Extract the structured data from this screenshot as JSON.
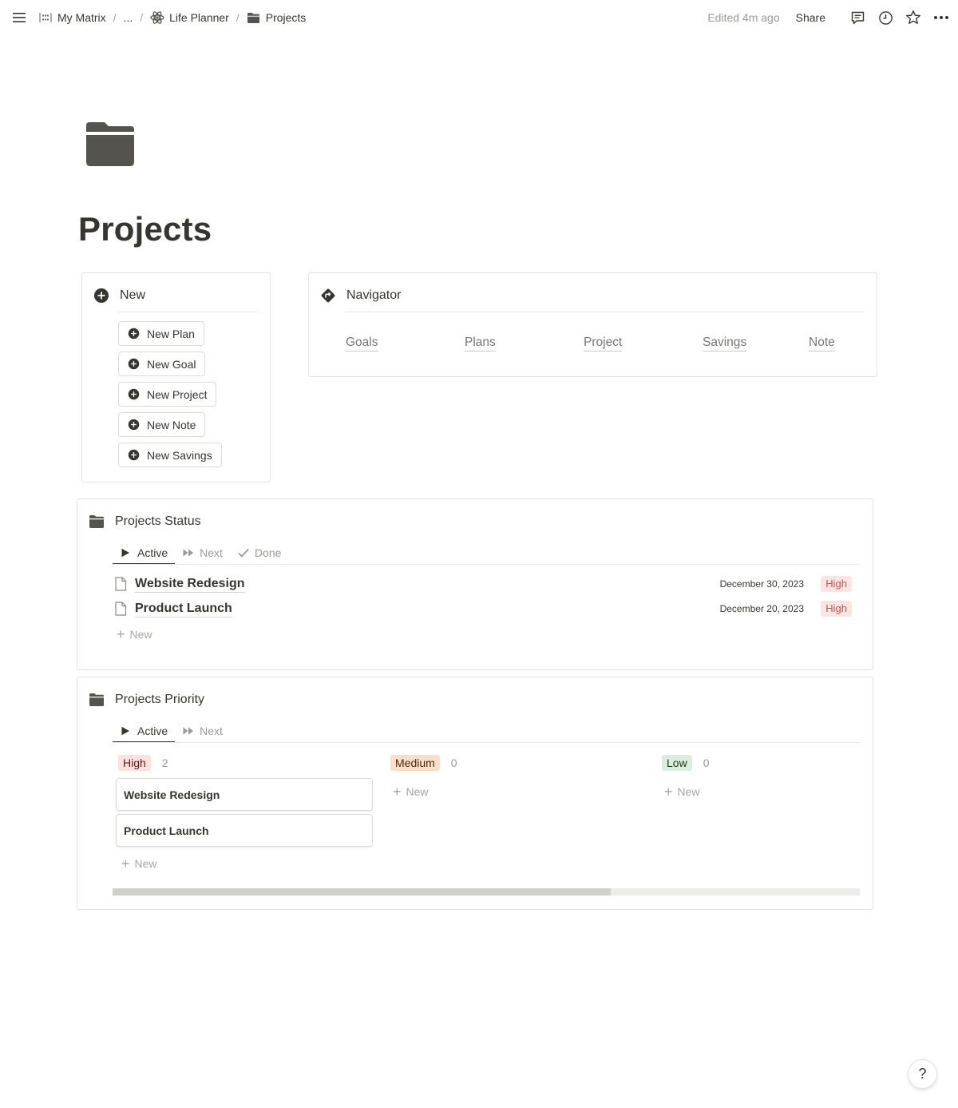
{
  "topbar": {
    "breadcrumbs": [
      {
        "label": "My Matrix",
        "icon": "matrix-icon"
      },
      {
        "label": "..."
      },
      {
        "label": "Life Planner",
        "icon": "atom-icon"
      },
      {
        "label": "Projects",
        "icon": "folder-icon"
      }
    ],
    "edited": "Edited 4m ago",
    "share": "Share"
  },
  "page": {
    "icon": "folder-icon",
    "title": "Projects"
  },
  "new_box": {
    "heading": "New",
    "buttons": [
      "New Plan",
      "New Goal",
      "New Project",
      "New Note",
      "New Savings"
    ]
  },
  "navigator": {
    "heading": "Navigator",
    "links": [
      "Goals",
      "Plans",
      "Project",
      "Savings",
      "Note"
    ]
  },
  "status_db": {
    "title": "Projects Status",
    "tabs": [
      "Active",
      "Next",
      "Done"
    ],
    "active_tab": "Active",
    "rows": [
      {
        "title": "Website Redesign",
        "date": "December 30, 2023",
        "priority": "High"
      },
      {
        "title": "Product Launch",
        "date": "December 20, 2023",
        "priority": "High"
      }
    ],
    "new_label": "New"
  },
  "priority_db": {
    "title": "Projects Priority",
    "tabs": [
      "Active",
      "Next"
    ],
    "active_tab": "Active",
    "columns": [
      {
        "label": "High",
        "count": "2",
        "cards": [
          "Website Redesign",
          "Product Launch"
        ]
      },
      {
        "label": "Medium",
        "count": "0",
        "cards": []
      },
      {
        "label": "Low",
        "count": "0",
        "cards": []
      }
    ],
    "new_label": "New",
    "scroll_fraction": 0.667
  },
  "help": "?",
  "colors": {
    "text": "#37352f",
    "muted": "#9b9a97",
    "high_bg": "#fbe4e4",
    "medium_bg": "#fadec9",
    "low_bg": "#dbeddb"
  }
}
